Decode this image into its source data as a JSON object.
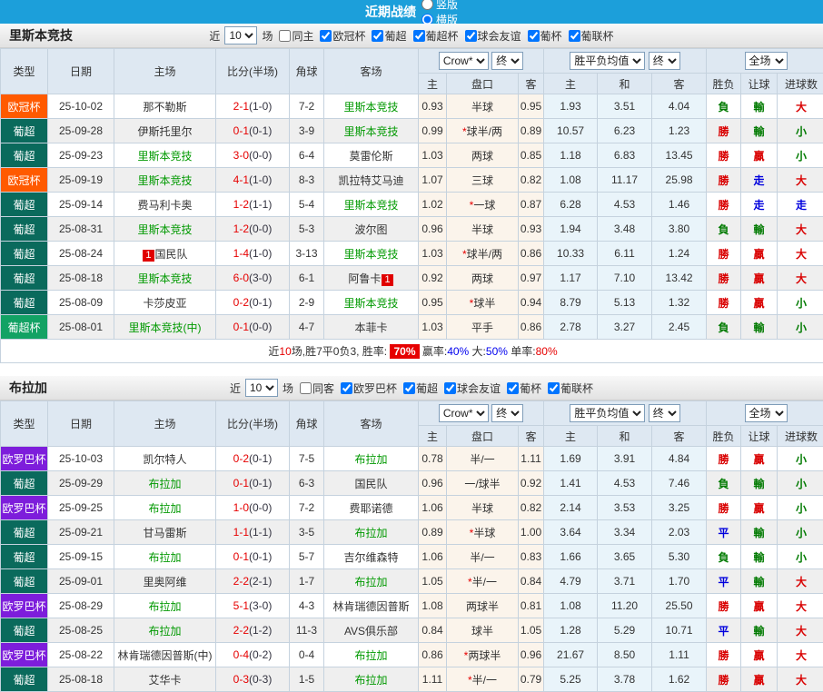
{
  "title_bar": {
    "title": "近期战绩",
    "layout_options": [
      {
        "label": "竖版",
        "selected": false
      },
      {
        "label": "横版",
        "selected": true
      }
    ]
  },
  "table_header": {
    "type": "类型",
    "date": "日期",
    "home": "主场",
    "score": "比分(半场)",
    "corner": "角球",
    "away": "客场",
    "odds_group": {
      "select1": "Crow*",
      "select2": "终",
      "sub": [
        "主",
        "盘口",
        "客"
      ]
    },
    "avg_group": {
      "select1": "胜平负均值",
      "select2": "终",
      "sub": [
        "主",
        "和",
        "客"
      ]
    },
    "result_group": {
      "select": "全场",
      "sub": [
        "胜负",
        "让球",
        "进球数"
      ]
    }
  },
  "colors": {
    "comp": {
      "欧冠杯": "#FF5A00",
      "葡超": "#0A6A5C",
      "葡超杯": "#12A264",
      "欧罗巴杯": "#7D1DDB"
    },
    "result": {
      "r": "#D90000",
      "g": "#007A00",
      "b": "#0000DD"
    },
    "accent_bar": "#1C9FDA"
  },
  "sections": [
    {
      "team": "里斯本竞技",
      "filters": {
        "prefix": "近",
        "count": "10",
        "suffix": "场",
        "same": {
          "label": "同主",
          "checked": false
        },
        "competitions": [
          "欧冠杯",
          "葡超",
          "葡超杯",
          "球会友谊",
          "葡杯",
          "葡联杯"
        ]
      },
      "rows": [
        {
          "comp": "欧冠杯",
          "date": "25-10-02",
          "home": "那不勒斯",
          "hf": false,
          "score": "2-1",
          "half": "(1-0)",
          "corner": "7-2",
          "away": "里斯本竞技",
          "af": true,
          "o1": "0.93",
          "hc": "半球",
          "o2": "0.95",
          "a1": "1.93",
          "a2": "3.51",
          "a3": "4.04",
          "r1": "負",
          "r2": "輸",
          "r3": "大"
        },
        {
          "comp": "葡超",
          "date": "25-09-28",
          "home": "伊斯托里尔",
          "hf": false,
          "score": "0-1",
          "half": "(0-1)",
          "corner": "3-9",
          "away": "里斯本竞技",
          "af": true,
          "o1": "0.99",
          "hc": "*球半/两",
          "o2": "0.89",
          "a1": "10.57",
          "a2": "6.23",
          "a3": "1.23",
          "r1": "勝",
          "r2": "輸",
          "r3": "小"
        },
        {
          "comp": "葡超",
          "date": "25-09-23",
          "home": "里斯本竞技",
          "hf": true,
          "score": "3-0",
          "half": "(0-0)",
          "corner": "6-4",
          "away": "莫雷伦斯",
          "af": false,
          "o1": "1.03",
          "hc": "两球",
          "o2": "0.85",
          "a1": "1.18",
          "a2": "6.83",
          "a3": "13.45",
          "r1": "勝",
          "r2": "贏",
          "r3": "小"
        },
        {
          "comp": "欧冠杯",
          "date": "25-09-19",
          "home": "里斯本竞技",
          "hf": true,
          "score": "4-1",
          "half": "(1-0)",
          "corner": "8-3",
          "away": "凯拉特艾马迪",
          "af": false,
          "o1": "1.07",
          "hc": "三球",
          "o2": "0.82",
          "a1": "1.08",
          "a2": "11.17",
          "a3": "25.98",
          "r1": "勝",
          "r2": "走",
          "r3": "大"
        },
        {
          "comp": "葡超",
          "date": "25-09-14",
          "home": "费马利卡奥",
          "hf": false,
          "score": "1-2",
          "half": "(1-1)",
          "corner": "5-4",
          "away": "里斯本竞技",
          "af": true,
          "o1": "1.02",
          "hc": "*一球",
          "o2": "0.87",
          "a1": "6.28",
          "a2": "4.53",
          "a3": "1.46",
          "r1": "勝",
          "r2": "走",
          "r3": "走"
        },
        {
          "comp": "葡超",
          "date": "25-08-31",
          "home": "里斯本竞技",
          "hf": true,
          "score": "1-2",
          "half": "(0-0)",
          "corner": "5-3",
          "away": "波尔图",
          "af": false,
          "o1": "0.96",
          "hc": "半球",
          "o2": "0.93",
          "a1": "1.94",
          "a2": "3.48",
          "a3": "3.80",
          "r1": "負",
          "r2": "輸",
          "r3": "大"
        },
        {
          "comp": "葡超",
          "date": "25-08-24",
          "home": "国民队",
          "hf": false,
          "hb": "1",
          "hbp": "before",
          "score": "1-4",
          "half": "(1-0)",
          "corner": "3-13",
          "away": "里斯本竞技",
          "af": true,
          "o1": "1.03",
          "hc": "*球半/两",
          "o2": "0.86",
          "a1": "10.33",
          "a2": "6.11",
          "a3": "1.24",
          "r1": "勝",
          "r2": "贏",
          "r3": "大"
        },
        {
          "comp": "葡超",
          "date": "25-08-18",
          "home": "里斯本竞技",
          "hf": true,
          "score": "6-0",
          "half": "(3-0)",
          "corner": "6-1",
          "away": "阿鲁卡",
          "af": false,
          "ab": "1",
          "abp": "after",
          "o1": "0.92",
          "hc": "两球",
          "o2": "0.97",
          "a1": "1.17",
          "a2": "7.10",
          "a3": "13.42",
          "r1": "勝",
          "r2": "贏",
          "r3": "大"
        },
        {
          "comp": "葡超",
          "date": "25-08-09",
          "home": "卡莎皮亚",
          "hf": false,
          "score": "0-2",
          "half": "(0-1)",
          "corner": "2-9",
          "away": "里斯本竞技",
          "af": true,
          "o1": "0.95",
          "hc": "*球半",
          "o2": "0.94",
          "a1": "8.79",
          "a2": "5.13",
          "a3": "1.32",
          "r1": "勝",
          "r2": "贏",
          "r3": "小"
        },
        {
          "comp": "葡超杯",
          "date": "25-08-01",
          "home": "里斯本竞技(中)",
          "hf": true,
          "score": "0-1",
          "half": "(0-0)",
          "corner": "4-7",
          "away": "本菲卡",
          "af": false,
          "o1": "1.03",
          "hc": "平手",
          "o2": "0.86",
          "a1": "2.78",
          "a2": "3.27",
          "a3": "2.45",
          "r1": "負",
          "r2": "輸",
          "r3": "小"
        }
      ],
      "summary": [
        {
          "t": "近",
          "c": "dark"
        },
        {
          "t": "10",
          "c": "red"
        },
        {
          "t": "场,胜7平0负3, 胜率: ",
          "c": "dark"
        },
        {
          "t": "70%",
          "c": "badge"
        },
        {
          "t": " 赢率:",
          "c": "dark"
        },
        {
          "t": "40%",
          "c": "blue"
        },
        {
          "t": " 大:",
          "c": "dark"
        },
        {
          "t": "50%",
          "c": "blue"
        },
        {
          "t": " 单率:",
          "c": "dark"
        },
        {
          "t": "80%",
          "c": "red"
        }
      ]
    },
    {
      "team": "布拉加",
      "filters": {
        "prefix": "近",
        "count": "10",
        "suffix": "场",
        "same": {
          "label": "同客",
          "checked": false
        },
        "competitions": [
          "欧罗巴杯",
          "葡超",
          "球会友谊",
          "葡杯",
          "葡联杯"
        ]
      },
      "rows": [
        {
          "comp": "欧罗巴杯",
          "date": "25-10-03",
          "home": "凯尔特人",
          "hf": false,
          "score": "0-2",
          "half": "(0-1)",
          "corner": "7-5",
          "away": "布拉加",
          "af": true,
          "o1": "0.78",
          "hc": "半/一",
          "o2": "1.11",
          "a1": "1.69",
          "a2": "3.91",
          "a3": "4.84",
          "r1": "勝",
          "r2": "贏",
          "r3": "小"
        },
        {
          "comp": "葡超",
          "date": "25-09-29",
          "home": "布拉加",
          "hf": true,
          "score": "0-1",
          "half": "(0-1)",
          "corner": "6-3",
          "away": "国民队",
          "af": false,
          "o1": "0.96",
          "hc": "一/球半",
          "o2": "0.92",
          "a1": "1.41",
          "a2": "4.53",
          "a3": "7.46",
          "r1": "負",
          "r2": "輸",
          "r3": "小"
        },
        {
          "comp": "欧罗巴杯",
          "date": "25-09-25",
          "home": "布拉加",
          "hf": true,
          "score": "1-0",
          "half": "(0-0)",
          "corner": "7-2",
          "away": "费耶诺德",
          "af": false,
          "o1": "1.06",
          "hc": "半球",
          "o2": "0.82",
          "a1": "2.14",
          "a2": "3.53",
          "a3": "3.25",
          "r1": "勝",
          "r2": "贏",
          "r3": "小"
        },
        {
          "comp": "葡超",
          "date": "25-09-21",
          "home": "甘马雷斯",
          "hf": false,
          "score": "1-1",
          "half": "(1-1)",
          "corner": "3-5",
          "away": "布拉加",
          "af": true,
          "o1": "0.89",
          "hc": "*半球",
          "o2": "1.00",
          "a1": "3.64",
          "a2": "3.34",
          "a3": "2.03",
          "r1": "平",
          "r2": "輸",
          "r3": "小"
        },
        {
          "comp": "葡超",
          "date": "25-09-15",
          "home": "布拉加",
          "hf": true,
          "score": "0-1",
          "half": "(0-1)",
          "corner": "5-7",
          "away": "吉尔维森特",
          "af": false,
          "o1": "1.06",
          "hc": "半/一",
          "o2": "0.83",
          "a1": "1.66",
          "a2": "3.65",
          "a3": "5.30",
          "r1": "負",
          "r2": "輸",
          "r3": "小"
        },
        {
          "comp": "葡超",
          "date": "25-09-01",
          "home": "里奥阿维",
          "hf": false,
          "score": "2-2",
          "half": "(2-1)",
          "corner": "1-7",
          "away": "布拉加",
          "af": true,
          "o1": "1.05",
          "hc": "*半/一",
          "o2": "0.84",
          "a1": "4.79",
          "a2": "3.71",
          "a3": "1.70",
          "r1": "平",
          "r2": "輸",
          "r3": "大"
        },
        {
          "comp": "欧罗巴杯",
          "date": "25-08-29",
          "home": "布拉加",
          "hf": true,
          "score": "5-1",
          "half": "(3-0)",
          "corner": "4-3",
          "away": "林肯瑞德因普斯",
          "af": false,
          "o1": "1.08",
          "hc": "两球半",
          "o2": "0.81",
          "a1": "1.08",
          "a2": "11.20",
          "a3": "25.50",
          "r1": "勝",
          "r2": "贏",
          "r3": "大"
        },
        {
          "comp": "葡超",
          "date": "25-08-25",
          "home": "布拉加",
          "hf": true,
          "score": "2-2",
          "half": "(1-2)",
          "corner": "11-3",
          "away": "AVS俱乐部",
          "af": false,
          "o1": "0.84",
          "hc": "球半",
          "o2": "1.05",
          "a1": "1.28",
          "a2": "5.29",
          "a3": "10.71",
          "r1": "平",
          "r2": "輸",
          "r3": "大"
        },
        {
          "comp": "欧罗巴杯",
          "date": "25-08-22",
          "home": "林肯瑞德因普斯(中)",
          "hf": false,
          "score": "0-4",
          "half": "(0-2)",
          "corner": "0-4",
          "away": "布拉加",
          "af": true,
          "o1": "0.86",
          "hc": "*两球半",
          "o2": "0.96",
          "a1": "21.67",
          "a2": "8.50",
          "a3": "1.11",
          "r1": "勝",
          "r2": "贏",
          "r3": "大"
        },
        {
          "comp": "葡超",
          "date": "25-08-18",
          "home": "艾华卡",
          "hf": false,
          "score": "0-3",
          "half": "(0-3)",
          "corner": "1-5",
          "away": "布拉加",
          "af": true,
          "o1": "1.11",
          "hc": "*半/一",
          "o2": "0.79",
          "a1": "5.25",
          "a2": "3.78",
          "a3": "1.62",
          "r1": "勝",
          "r2": "贏",
          "r3": "大"
        }
      ],
      "summary": null
    }
  ]
}
